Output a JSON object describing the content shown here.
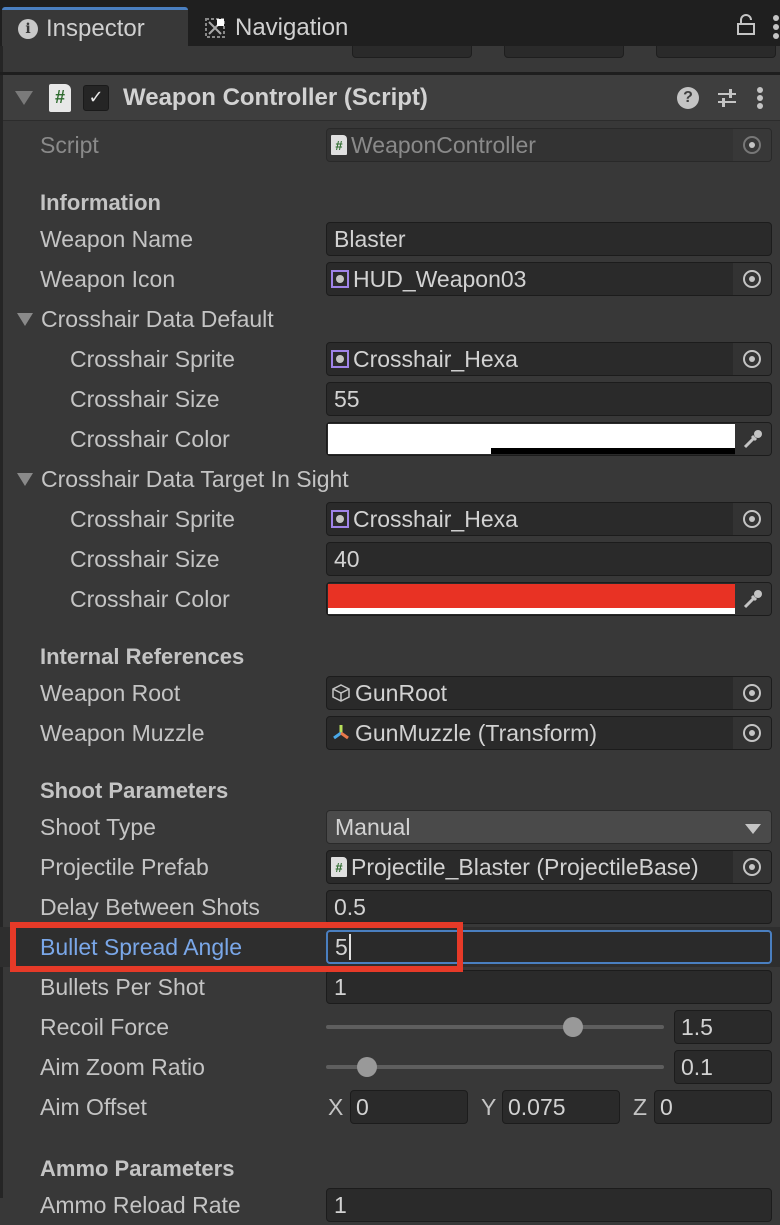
{
  "tabs": [
    {
      "label": "Inspector",
      "icon": "info-icon",
      "active": true
    },
    {
      "label": "Navigation",
      "icon": "navigation-icon",
      "active": false
    }
  ],
  "component": {
    "title": "Weapon Controller (Script)",
    "enabled": true,
    "script_label": "Script",
    "script_value": "WeaponController"
  },
  "sections": {
    "information": "Information",
    "internal_references": "Internal References",
    "shoot_parameters": "Shoot Parameters",
    "ammo_parameters": "Ammo Parameters"
  },
  "fields": {
    "weapon_name": {
      "label": "Weapon Name",
      "value": "Blaster"
    },
    "weapon_icon": {
      "label": "Weapon Icon",
      "value": "HUD_Weapon03"
    },
    "crosshair_default": {
      "label": "Crosshair Data Default",
      "sprite": {
        "label": "Crosshair Sprite",
        "value": "Crosshair_Hexa"
      },
      "size": {
        "label": "Crosshair Size",
        "value": "55"
      },
      "color": {
        "label": "Crosshair Color",
        "value": "#ffffff",
        "alpha": 0.4
      }
    },
    "crosshair_target": {
      "label": "Crosshair Data Target In Sight",
      "sprite": {
        "label": "Crosshair Sprite",
        "value": "Crosshair_Hexa"
      },
      "size": {
        "label": "Crosshair Size",
        "value": "40"
      },
      "color": {
        "label": "Crosshair Color",
        "value": "#e83224",
        "alpha": 1.0
      }
    },
    "weapon_root": {
      "label": "Weapon Root",
      "value": "GunRoot"
    },
    "weapon_muzzle": {
      "label": "Weapon Muzzle",
      "value": "GunMuzzle (Transform)"
    },
    "shoot_type": {
      "label": "Shoot Type",
      "value": "Manual"
    },
    "projectile_prefab": {
      "label": "Projectile Prefab",
      "value": "Projectile_Blaster (ProjectileBase)"
    },
    "delay_between_shots": {
      "label": "Delay Between Shots",
      "value": "0.5"
    },
    "bullet_spread_angle": {
      "label": "Bullet Spread Angle",
      "value": "5"
    },
    "bullets_per_shot": {
      "label": "Bullets Per Shot",
      "value": "1"
    },
    "recoil_force": {
      "label": "Recoil Force",
      "value": "1.5",
      "slider_fraction": 0.73
    },
    "aim_zoom_ratio": {
      "label": "Aim Zoom Ratio",
      "value": "0.1",
      "slider_fraction": 0.12
    },
    "aim_offset": {
      "label": "Aim Offset",
      "x_label": "X",
      "x": "0",
      "y_label": "Y",
      "y": "0.075",
      "z_label": "Z",
      "z": "0"
    },
    "ammo_reload_rate": {
      "label": "Ammo Reload Rate",
      "value": "1"
    }
  },
  "highlight_color": "#e63a28",
  "focus_color": "#4a7fc0"
}
